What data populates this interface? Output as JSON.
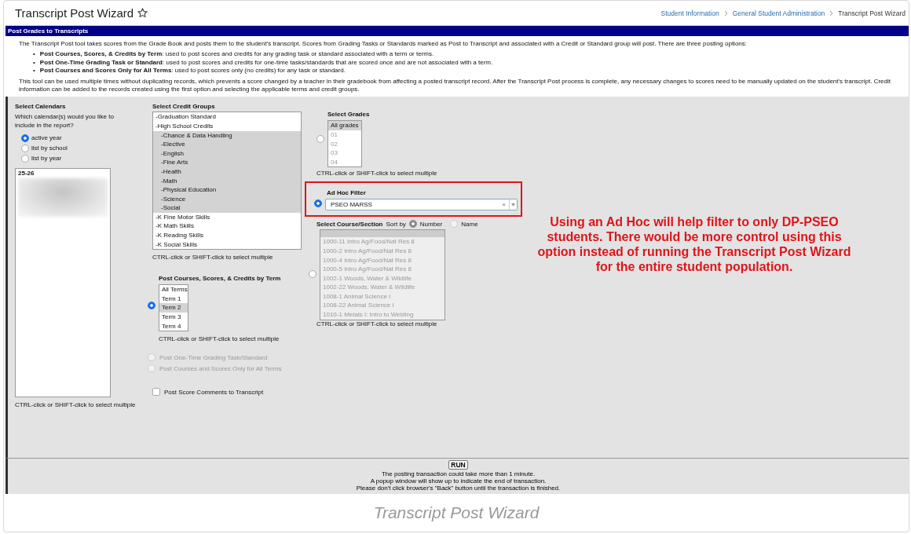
{
  "header": {
    "title": "Transcript Post Wizard",
    "favorite": false,
    "breadcrumbs": [
      {
        "label": "Student Information",
        "link": true
      },
      {
        "label": "General Student Administration",
        "link": true
      },
      {
        "label": "Transcript Post Wizard",
        "link": false
      }
    ]
  },
  "section_bar": {
    "title": "Post Grades to Transcripts"
  },
  "intro": {
    "paragraph": "The Transcript Post tool takes scores from the Grade Book and posts them to the student's transcript. Scores from Grading Tasks or Standards marked as Post to Transcript and associated with a Credit or Standard group will post. There are three posting options:",
    "bullet": "•",
    "bullets": [
      "**Post Courses, Scores, & Credits by Term**: used to post scores and credits for any grading task or standard associated with a term or terms.",
      "**Post One-Time Grading Task or Standard**: used to post scores and credits for one-time tasks/standards that are scored once and are not associated with a term.",
      "**Post Courses and Scores Only for All Terms**: used to post scores only (no credits) for any task or standard."
    ],
    "paragraph_2": "This tool can be used multiple times without duplicating records, which prevents a score changed by a teacher in their gradebook from affecting a posted transcript record. After the Transcript Post process is complete, any necessary changes to scores need to be manually updated on the student's transcript. Credit information can be added to the records created using the first option and selecting the applicable terms and credit groups."
  },
  "calendars": {
    "heading": "Select Calendars",
    "question": "Which calendar(s) would you like to include in the report?",
    "options": [
      {
        "label": "active year",
        "selected": true
      },
      {
        "label": "list by school",
        "selected": false
      },
      {
        "label": "list by year",
        "selected": false
      }
    ],
    "list": [
      {
        "label": "25-26",
        "selected": false
      }
    ],
    "redacted": true,
    "hint": "CTRL-click or SHIFT-click to select multiple"
  },
  "credit_groups": {
    "heading": "Select Credit Groups",
    "items": [
      {
        "label": "-Graduation Standard",
        "selected": false
      },
      {
        "label": "-High School Credits",
        "selected": false,
        "children": [
          {
            "label": "-Chance & Data Handling",
            "selected": true
          },
          {
            "label": "-Elective",
            "selected": true
          },
          {
            "label": "-English",
            "selected": true
          },
          {
            "label": "-Fine Arts",
            "selected": true
          },
          {
            "label": "-Health",
            "selected": true
          },
          {
            "label": "-Math",
            "selected": true
          },
          {
            "label": "-Physical Education",
            "selected": true
          },
          {
            "label": "-Science",
            "selected": true
          },
          {
            "label": "-Social",
            "selected": true
          }
        ]
      },
      {
        "label": "-K Fine Motor Skills",
        "selected": false
      },
      {
        "label": "-K Math Skills",
        "selected": false
      },
      {
        "label": "-K Reading Skills",
        "selected": false
      },
      {
        "label": "-K Social Skills",
        "selected": false
      }
    ],
    "hint": "CTRL-click or SHIFT-click to select multiple"
  },
  "posting_options": [
    {
      "kind": "terms",
      "label": "Post Courses, Scores, & Credits by Term",
      "selected": true,
      "disabled": false,
      "terms": [
        {
          "label": "All Terms",
          "selected": false
        },
        {
          "label": "Term 1",
          "selected": false
        },
        {
          "label": "Term 2",
          "selected": true
        },
        {
          "label": "Term 3",
          "selected": false
        },
        {
          "label": "Term 4",
          "selected": false
        }
      ],
      "hint": "CTRL-click or SHIFT-click to select multiple"
    },
    {
      "kind": "plain",
      "label": "Post One-Time Grading Task/Standard",
      "selected": false,
      "disabled": true
    },
    {
      "kind": "plain",
      "label": "Post Courses and Scores Only for All Terms",
      "selected": false,
      "disabled": true
    }
  ],
  "score_comments": {
    "label": "Post Score Comments to Transcript",
    "checked": false
  },
  "filters": [
    {
      "kind": "grades",
      "selected": false,
      "heading": "Select Grades",
      "items": [
        {
          "label": "All grades",
          "selected": true
        },
        {
          "label": "01",
          "selected": false
        },
        {
          "label": "02",
          "selected": false
        },
        {
          "label": "03",
          "selected": false
        },
        {
          "label": "04",
          "selected": false
        }
      ],
      "hint": "CTRL-click or SHIFT-click to select multiple"
    },
    {
      "kind": "adhoc",
      "selected": true,
      "highlighted": true,
      "heading": "Ad Hoc Filter",
      "value": "PSEO MARSS",
      "clear": "×"
    },
    {
      "kind": "course",
      "selected": false,
      "heading": "Select Course/Section",
      "sort_label": "Sort by",
      "sort_options": [
        {
          "label": "Number",
          "selected": true
        },
        {
          "label": "Name",
          "selected": false
        }
      ],
      "items": [
        {
          "label": "1000-11 Intro Ag/Food/Nat Res 8"
        },
        {
          "label": "1000-2 Intro Ag/Food/Nat Res 8"
        },
        {
          "label": "1000-4 Intro Ag/Food/Nat Res 8"
        },
        {
          "label": "1000-5 Intro Ag/Food/Nat Res 8"
        },
        {
          "label": "1002-1 Woods, Water & Wildlife"
        },
        {
          "label": "1002-22 Woods, Water & Wildlife"
        },
        {
          "label": "1008-1 Animal Science I"
        },
        {
          "label": "1008-22 Animal Science I"
        },
        {
          "label": "1010-1 Metals I: Intro to Welding"
        }
      ],
      "hint": "CTRL-click or SHIFT-click to select multiple"
    }
  ],
  "annotation": "Using an Ad Hoc will help filter to only DP-PSEO students.  There would be more control using this option instead of running the Transcript Post Wizard for the entire student population.",
  "footer": {
    "button": "RUN",
    "lines": [
      "The posting transaction could take more than 1 minute.",
      "A popup window will show up to indicate the end of transaction.",
      "Please don't click browser's \"Back\" button until the transaction is finished."
    ]
  },
  "caption": "Transcript Post Wizard"
}
